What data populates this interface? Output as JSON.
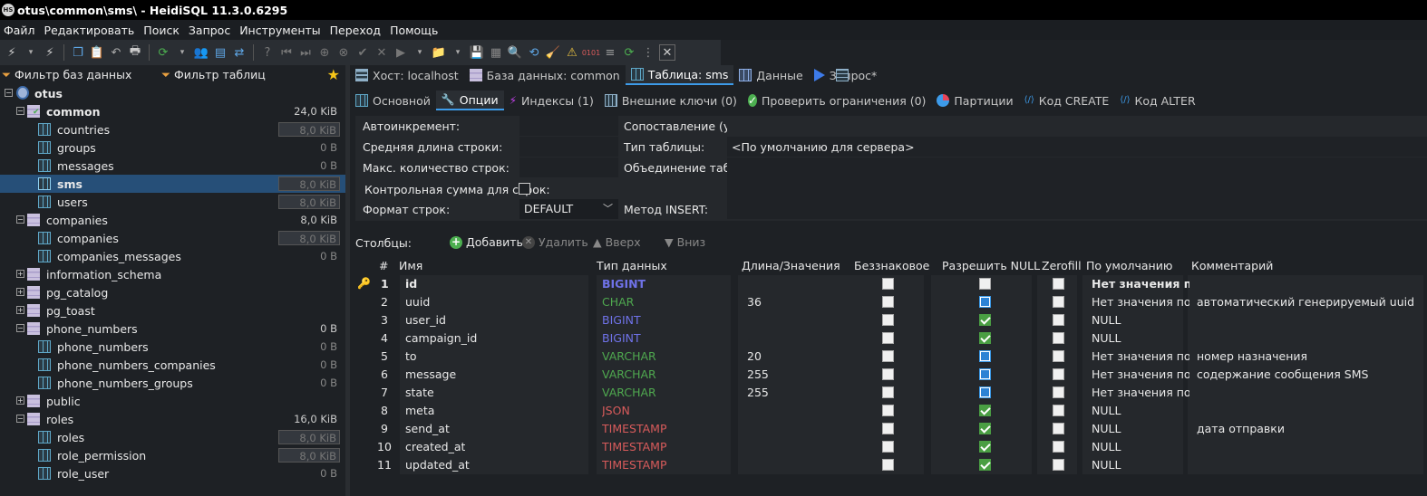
{
  "window": {
    "title": "otus\\common\\sms\\ - HeidiSQL 11.3.0.6295",
    "app_icon": "HS"
  },
  "menu": [
    "Файл",
    "Редактировать",
    "Поиск",
    "Запрос",
    "Инструменты",
    "Переход",
    "Помощь"
  ],
  "sidebar": {
    "filter_db": "Фильтр баз данных",
    "filter_tables": "Фильтр таблиц",
    "root": "otus",
    "items": [
      {
        "name": "common",
        "size": "24,0 KiB",
        "level": 1,
        "type": "db",
        "expanded": true
      },
      {
        "name": "countries",
        "size": "8,0 KiB",
        "level": 2,
        "type": "table",
        "box": true
      },
      {
        "name": "groups",
        "size": "0 B",
        "level": 2,
        "type": "table"
      },
      {
        "name": "messages",
        "size": "0 B",
        "level": 2,
        "type": "table"
      },
      {
        "name": "sms",
        "size": "8,0 KiB",
        "level": 2,
        "type": "table",
        "box": true,
        "selected": true
      },
      {
        "name": "users",
        "size": "8,0 KiB",
        "level": 2,
        "type": "table",
        "box": true
      },
      {
        "name": "companies",
        "size": "8,0 KiB",
        "level": 1,
        "type": "db",
        "expanded": true
      },
      {
        "name": "companies",
        "size": "8,0 KiB",
        "level": 2,
        "type": "table",
        "box": true
      },
      {
        "name": "companies_messages",
        "size": "0 B",
        "level": 2,
        "type": "table"
      },
      {
        "name": "information_schema",
        "size": "",
        "level": 1,
        "type": "db"
      },
      {
        "name": "pg_catalog",
        "size": "",
        "level": 1,
        "type": "db"
      },
      {
        "name": "pg_toast",
        "size": "",
        "level": 1,
        "type": "db"
      },
      {
        "name": "phone_numbers",
        "size": "0 B",
        "level": 1,
        "type": "db",
        "expanded": true
      },
      {
        "name": "phone_numbers",
        "size": "0 B",
        "level": 2,
        "type": "table"
      },
      {
        "name": "phone_numbers_companies",
        "size": "0 B",
        "level": 2,
        "type": "table"
      },
      {
        "name": "phone_numbers_groups",
        "size": "0 B",
        "level": 2,
        "type": "table"
      },
      {
        "name": "public",
        "size": "",
        "level": 1,
        "type": "db"
      },
      {
        "name": "roles",
        "size": "16,0 KiB",
        "level": 1,
        "type": "db",
        "expanded": true
      },
      {
        "name": "roles",
        "size": "8,0 KiB",
        "level": 2,
        "type": "table",
        "box": true
      },
      {
        "name": "role_permission",
        "size": "8,0 KiB",
        "level": 2,
        "type": "table",
        "box": true
      },
      {
        "name": "role_user",
        "size": "0 B",
        "level": 2,
        "type": "table"
      }
    ]
  },
  "tabs_main": [
    {
      "label": "Хост: localhost",
      "icon": "host-icon"
    },
    {
      "label": "База данных: common",
      "icon": "database-icon"
    },
    {
      "label": "Таблица: sms",
      "icon": "table-icon",
      "active": true
    },
    {
      "label": "Данные",
      "icon": "data-grid-icon"
    },
    {
      "label": "Запрос*",
      "icon": "play-icon"
    }
  ],
  "tabs_sub": [
    {
      "label": "Основной",
      "icon": "table-icon"
    },
    {
      "label": "Опции",
      "icon": "wrench-icon",
      "active": true
    },
    {
      "label": "Индексы (1)",
      "icon": "lightning-icon"
    },
    {
      "label": "Внешние ключи (0)",
      "icon": "foreign-key-icon"
    },
    {
      "label": "Проверить ограничения (0)",
      "icon": "check-circle-icon"
    },
    {
      "label": "Партиции",
      "icon": "pie-icon"
    },
    {
      "label": "Код CREATE",
      "icon": "code-icon"
    },
    {
      "label": "Код ALTER",
      "icon": "code-icon"
    }
  ],
  "options": {
    "auto_increment_label": "Автоинкремент:",
    "avg_row_label": "Средняя длина строки:",
    "max_rows_label": "Макс. количество строк:",
    "checksum_label": "Контрольная сумма для строк:",
    "row_format_label": "Формат строк:",
    "row_format_value": "DEFAULT",
    "collation_label": "Сопоставление (умо",
    "table_type_label": "Тип таблицы:",
    "table_type_value": "<По умолчанию для сервера>",
    "union_label": "Объединение таблиц",
    "insert_method_label": "Метод INSERT:"
  },
  "columns_bar": {
    "label": "Столбцы:",
    "add": "Добавить",
    "remove": "Удалить",
    "up": "Вверх",
    "down": "Вниз"
  },
  "grid": {
    "headers": [
      "#",
      "Имя",
      "Тип данных",
      "Длина/Значения",
      "Беззнаковое",
      "Разрешить NULL",
      "Zerofill",
      "По умолчанию",
      "Комментарий"
    ],
    "rows": [
      {
        "n": "1",
        "name": "id",
        "type": "BIGINT",
        "tcolor": "#6f72e8",
        "len": "",
        "nullable": "none",
        "def": "Нет значения п...",
        "comment": "",
        "key": true
      },
      {
        "n": "2",
        "name": "uuid",
        "type": "CHAR",
        "tcolor": "#4fa84f",
        "len": "36",
        "nullable": "blue",
        "def": "Нет значения по...",
        "comment": "автоматический генерируемый uuid"
      },
      {
        "n": "3",
        "name": "user_id",
        "type": "BIGINT",
        "tcolor": "#6f72e8",
        "len": "",
        "nullable": "on",
        "def": "NULL",
        "comment": ""
      },
      {
        "n": "4",
        "name": "campaign_id",
        "type": "BIGINT",
        "tcolor": "#6f72e8",
        "len": "",
        "nullable": "on",
        "def": "NULL",
        "comment": ""
      },
      {
        "n": "5",
        "name": "to",
        "type": "VARCHAR",
        "tcolor": "#4fa84f",
        "len": "20",
        "nullable": "blue",
        "def": "Нет значения по...",
        "comment": "номер назначения"
      },
      {
        "n": "6",
        "name": "message",
        "type": "VARCHAR",
        "tcolor": "#4fa84f",
        "len": "255",
        "nullable": "blue",
        "def": "Нет значения по...",
        "comment": "содержание сообщения SMS"
      },
      {
        "n": "7",
        "name": "state",
        "type": "VARCHAR",
        "tcolor": "#4fa84f",
        "len": "255",
        "nullable": "blue",
        "def": "Нет значения по...",
        "comment": ""
      },
      {
        "n": "8",
        "name": "meta",
        "type": "JSON",
        "tcolor": "#d85b5b",
        "len": "",
        "nullable": "on",
        "def": "NULL",
        "comment": ""
      },
      {
        "n": "9",
        "name": "send_at",
        "type": "TIMESTAMP",
        "tcolor": "#d85b5b",
        "len": "",
        "nullable": "on",
        "def": "NULL",
        "comment": "дата отправки"
      },
      {
        "n": "10",
        "name": "created_at",
        "type": "TIMESTAMP",
        "tcolor": "#d85b5b",
        "len": "",
        "nullable": "on",
        "def": "NULL",
        "comment": ""
      },
      {
        "n": "11",
        "name": "updated_at",
        "type": "TIMESTAMP",
        "tcolor": "#d85b5b",
        "len": "",
        "nullable": "on",
        "def": "NULL",
        "comment": ""
      }
    ]
  }
}
